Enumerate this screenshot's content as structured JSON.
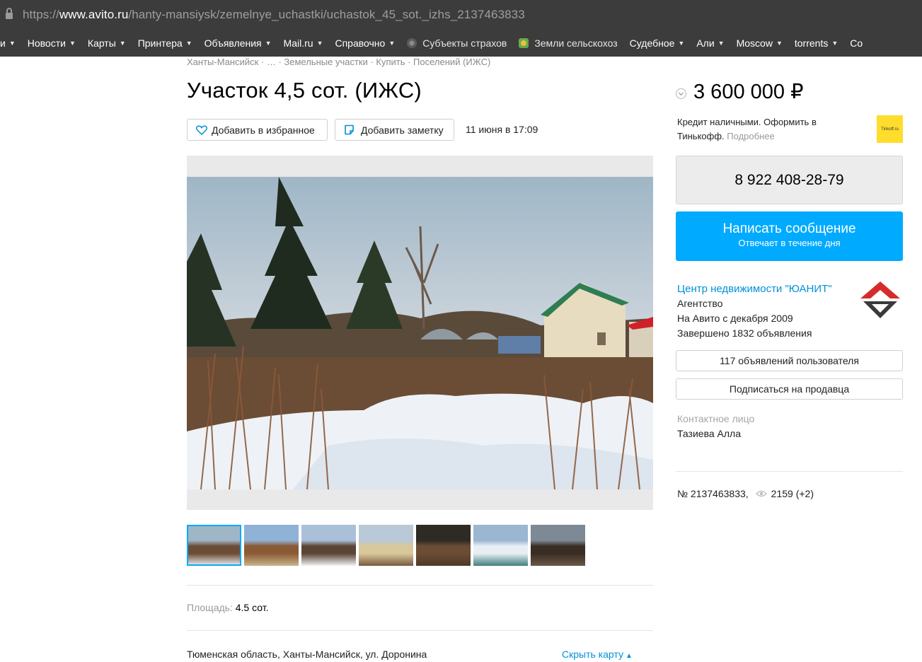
{
  "browser": {
    "url_scheme": "https://",
    "url_host": "www.avito.ru",
    "url_path": "/hanty-mansiysk/zemelnye_uchastki/uchastok_45_sot._izhs_2137463833",
    "bookmarks": [
      {
        "label": "и",
        "has_menu": true
      },
      {
        "label": "Новости",
        "has_menu": true
      },
      {
        "label": "Карты",
        "has_menu": true
      },
      {
        "label": "Принтера",
        "has_menu": true
      },
      {
        "label": "Объявления",
        "has_menu": true
      },
      {
        "label": "Mail.ru",
        "has_menu": true
      },
      {
        "label": "Справочно",
        "has_menu": true
      },
      {
        "label": "Субъекты страхов",
        "icon": "seal-icon",
        "has_menu": false
      },
      {
        "label": "Земли сельскохоз",
        "icon": "horse-icon",
        "has_menu": false
      },
      {
        "label": "Судебное",
        "has_menu": true
      },
      {
        "label": "Али",
        "has_menu": true
      },
      {
        "label": "Moscow",
        "has_menu": true
      },
      {
        "label": "torrents",
        "has_menu": true
      },
      {
        "label": "Со",
        "has_menu": false
      }
    ]
  },
  "listing": {
    "breadcrumbs": "Ханты-Мансийск · … · Земельные участки · Купить · Поселений (ИЖС)",
    "title": "Участок 4,5 сот. (ИЖС)",
    "favorite_label": "Добавить в избранное",
    "note_label": "Добавить заметку",
    "date": "11 июня в 17:09",
    "thumbnail_count": 7,
    "param_label": "Площадь:",
    "param_value": "4.5 сот.",
    "address": "Тюменская область, Ханты-Мансийск, ул. Доронина",
    "hide_map_label": "Скрыть карту"
  },
  "sidebar": {
    "price": "3 600 000 ₽",
    "credit_text": "Кредит наличными. Оформить в Тинькофф.",
    "credit_more": "Подробнее",
    "bank_logo_text": "Tinkoff.ru",
    "phone": "8 922 408-28-79",
    "message_label": "Написать сообщение",
    "message_sub": "Отвечает в течение дня",
    "seller_name": "Центр недвижимости \"ЮАНИТ\"",
    "seller_type": "Агентство",
    "seller_since": "На Авито с декабря 2009",
    "seller_completed": "Завершено 1832 объявления",
    "user_ads_label": "117 объявлений пользователя",
    "subscribe_label": "Подписаться на продавца",
    "contact_label": "Контактное лицо",
    "contact_name": "Тазиева Алла",
    "ad_number": "№ 2137463833,",
    "views": "2159 (+2)"
  },
  "colors": {
    "accent_blue": "#00aaff",
    "link_blue": "#0091d9",
    "chrome_dark": "#3c3c3c",
    "bank_yellow": "#ffdd2d"
  }
}
